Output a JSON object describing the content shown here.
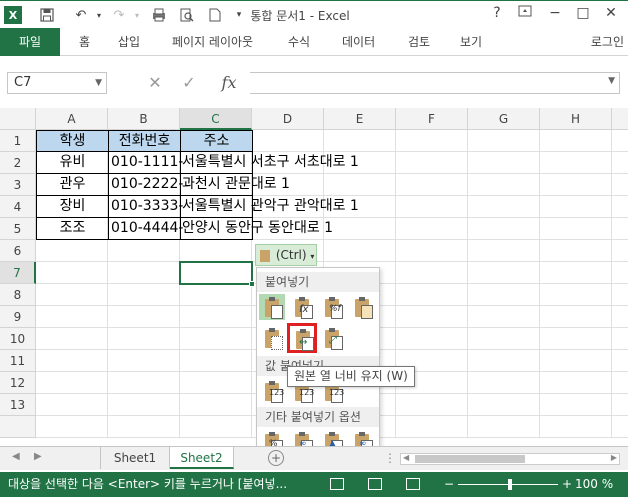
{
  "window": {
    "title": "통합 문서1 - Excel",
    "help": "?",
    "minimize": "−",
    "restore": "□",
    "close": "✕"
  },
  "ribbon": {
    "tabs": [
      "파일",
      "홈",
      "삽입",
      "페이지 레이아웃",
      "수식",
      "데이터",
      "검토",
      "보기"
    ],
    "login": "로그인"
  },
  "formula": {
    "namebox": "C7",
    "cancel": "✕",
    "enter": "✓",
    "fx": "fx",
    "value": ""
  },
  "columns": [
    "A",
    "B",
    "C",
    "D",
    "E",
    "F",
    "G",
    "H"
  ],
  "rows": [
    "1",
    "2",
    "3",
    "4",
    "5",
    "6",
    "7",
    "8",
    "9",
    "10",
    "11",
    "12",
    "13"
  ],
  "table": {
    "headers": [
      "학생",
      "전화번호",
      "주소"
    ],
    "data": [
      [
        "유비",
        "010-1111-",
        "서울특별시 서초구 서초대로 1"
      ],
      [
        "관우",
        "010-2222-",
        "과천시 관문대로 1"
      ],
      [
        "장비",
        "010-3333-",
        "서울특별시 관악구 관악대로 1"
      ],
      [
        "조조",
        "010-4444-",
        "안양시 동안구 동안대로 1"
      ]
    ]
  },
  "paste_options": {
    "button_label": "(Ctrl)",
    "section_paste": "붙여넣기",
    "section_values": "값 붙여넣기",
    "section_other": "기타 붙여넣기 옵션",
    "tooltip": "원본 열 너비 유지 (W)"
  },
  "sheets": [
    "Sheet1",
    "Sheet2"
  ],
  "active_sheet": "Sheet2",
  "status": {
    "message": "대상을 선택한 다음 <Enter> 키를 누르거나 [붙여넣...",
    "zoom": "100 %"
  },
  "colors": {
    "accent": "#217346",
    "header_fill": "#bdd7ee",
    "highlight": "#e02020"
  }
}
